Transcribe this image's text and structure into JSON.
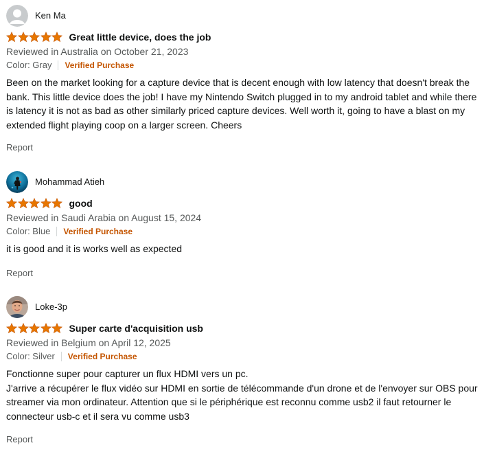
{
  "colors": {
    "star": "#e77600",
    "verified": "#c45500",
    "muted": "#565959",
    "text": "#0f1111"
  },
  "reviews": [
    {
      "profile_name": "Ken Ma",
      "avatar_icon": "default-user-icon",
      "rating": 5,
      "rating_text": "5 out of 5 stars",
      "title": "Great little device, does the job",
      "date": "Reviewed in Australia on October 21, 2023",
      "format": "Color: Gray",
      "verified": "Verified Purchase",
      "body": "Been on the market looking for a capture device that is decent enough with low latency that doesn't break the bank. This little device does the job! I have my Nintendo Switch plugged in to my android tablet and while there is latency it is not as bad as other similarly priced capture devices. Well worth it, going to have a blast on my extended flight playing coop on a larger screen. Cheers",
      "report": "Report"
    },
    {
      "profile_name": "Mohammad Atieh",
      "avatar_icon": "diver-photo-avatar",
      "rating": 5,
      "rating_text": "5 out of 5 stars",
      "title": "good",
      "date": "Reviewed in Saudi Arabia on August 15, 2024",
      "format": "Color: Blue",
      "verified": "Verified Purchase",
      "body": "it is good and it is works well as expected",
      "report": "Report"
    },
    {
      "profile_name": "Loke-3p",
      "avatar_icon": "person-photo-avatar",
      "rating": 5,
      "rating_text": "5 out of 5 stars",
      "title": "Super carte d'acquisition usb",
      "date": "Reviewed in Belgium on April 12, 2025",
      "format": "Color: Silver",
      "verified": "Verified Purchase",
      "body": "Fonctionne super pour capturer un flux HDMI vers un pc.\nJ'arrive a récupérer le flux vidéo sur HDMI en sortie de télécommande d'un drone et de l'envoyer sur OBS pour streamer via mon ordinateur. Attention que si le périphérique est reconnu comme usb2 il faut retourner le connecteur usb-c et il sera vu comme usb3",
      "report": "Report"
    }
  ]
}
